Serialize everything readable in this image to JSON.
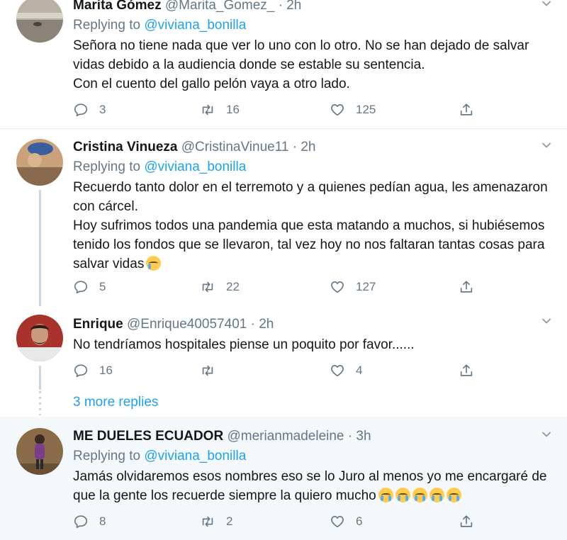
{
  "tweets": [
    {
      "name": "Marita Gómez",
      "handle": "@Marita_Gomez_",
      "dot": "·",
      "time": "2h",
      "replying_label": "Replying to",
      "replying_to": "@viviana_bonilla",
      "lines": [
        "Señora no tiene nada que ver lo uno con lo otro. No se han dejado de salvar vidas debido a la audiencia donde se estable su sentencia.",
        "Con el cuento del gallo pelón vaya a otro lado."
      ],
      "replies": "3",
      "retweets": "16",
      "likes": "125"
    },
    {
      "name": "Cristina Vinueza",
      "handle": "@CristinaVinue11",
      "dot": "·",
      "time": "2h",
      "replying_label": "Replying to",
      "replying_to": "@viviana_bonilla",
      "lines": [
        "Recuerdo tanto dolor en el terremoto y a quienes pedían agua, les amenazaron con cárcel.",
        "Hoy sufrimos todos una pandemia que esta matando a muchos, si hubiésemos tenido los fondos que se llevaron, tal vez hoy no nos faltaran tantas cosas para salvar vidas"
      ],
      "emoji": "crying-face",
      "replies": "5",
      "retweets": "22",
      "likes": "127"
    },
    {
      "name": "Enrique",
      "handle": "@Enrique40057401",
      "dot": "·",
      "time": "2h",
      "lines": [
        "No tendríamos hospitales piense un poquito por favor......"
      ],
      "replies": "16",
      "retweets": "",
      "likes": "4"
    },
    {
      "name": "ME DUELES ECUADOR",
      "handle": "@merianmadeleine",
      "dot": "·",
      "time": "3h",
      "replying_label": "Replying to",
      "replying_to": "@viviana_bonilla",
      "lines": [
        "Jamás olvidaremos esos nombres eso se lo Juro al menos yo me encargaré de que la gente los recuerde siempre la quiero mucho"
      ],
      "emoji": "loudly-crying-face",
      "emoji_count": 5,
      "replies": "8",
      "retweets": "2",
      "likes": "6"
    }
  ],
  "more_replies": "3 more replies",
  "colors": {
    "link": "#1da1f2",
    "muted": "#657786",
    "text": "#14171a",
    "highlight_bg": "#f5f8fa",
    "divider": "#e6ecf0"
  },
  "icons": [
    "reply-icon",
    "retweet-icon",
    "like-icon",
    "share-icon",
    "chevron-down-icon"
  ]
}
